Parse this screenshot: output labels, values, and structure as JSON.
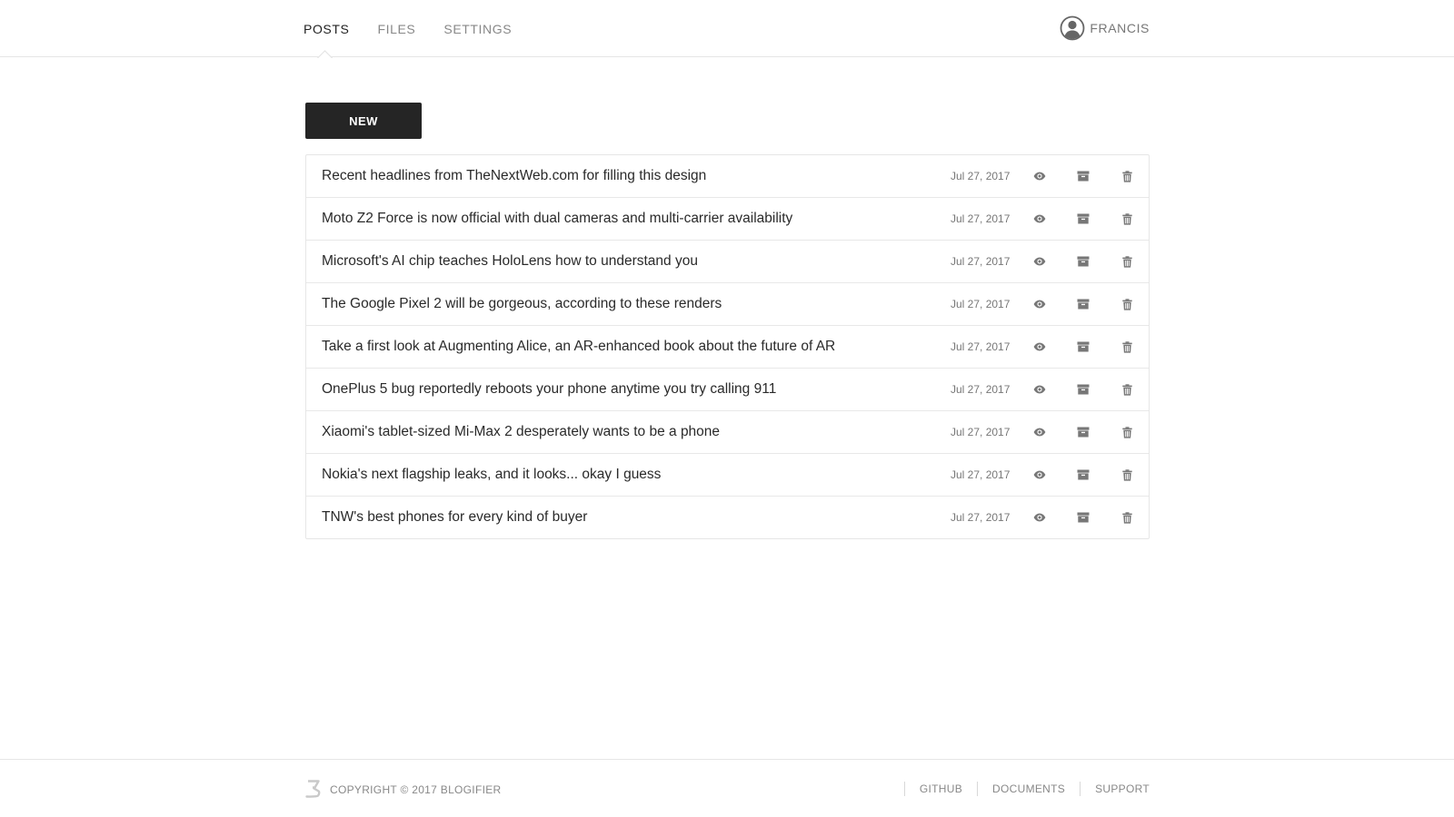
{
  "nav": {
    "tabs": [
      {
        "label": "POSTS",
        "active": true
      },
      {
        "label": "FILES",
        "active": false
      },
      {
        "label": "SETTINGS",
        "active": false
      }
    ],
    "user": {
      "name": "FRANCIS",
      "icon": "user-circle-icon"
    }
  },
  "main": {
    "new_button_label": "NEW",
    "posts": [
      {
        "title": "Recent headlines from TheNextWeb.com for filling this design",
        "date": "Jul 27, 2017"
      },
      {
        "title": "Moto Z2 Force is now official with dual cameras and multi-carrier availability",
        "date": "Jul 27, 2017"
      },
      {
        "title": "Microsoft's AI chip teaches HoloLens how to understand you",
        "date": "Jul 27, 2017"
      },
      {
        "title": "The Google Pixel 2 will be gorgeous, according to these renders",
        "date": "Jul 27, 2017"
      },
      {
        "title": "Take a first look at Augmenting Alice, an AR-enhanced book about the future of AR",
        "date": "Jul 27, 2017"
      },
      {
        "title": "OnePlus 5 bug reportedly reboots your phone anytime you try calling 911",
        "date": "Jul 27, 2017"
      },
      {
        "title": "Xiaomi's tablet-sized Mi-Max 2 desperately wants to be a phone",
        "date": "Jul 27, 2017"
      },
      {
        "title": "Nokia's next flagship leaks, and it looks... okay I guess",
        "date": "Jul 27, 2017"
      },
      {
        "title": "TNW's best phones for every kind of buyer",
        "date": "Jul 27, 2017"
      }
    ],
    "row_actions": {
      "view": "eye-icon",
      "archive": "archive-icon",
      "delete": "trash-icon"
    }
  },
  "footer": {
    "logo": "blogifier-logo-icon",
    "copyright": "COPYRIGHT © 2017 BLOGIFIER",
    "links": [
      "GITHUB",
      "DOCUMENTS",
      "SUPPORT"
    ]
  },
  "colors": {
    "button_bg": "#252525",
    "icon": "#777777",
    "border": "#e6e6e6",
    "text": "#2a2a2a",
    "muted": "#888888"
  }
}
